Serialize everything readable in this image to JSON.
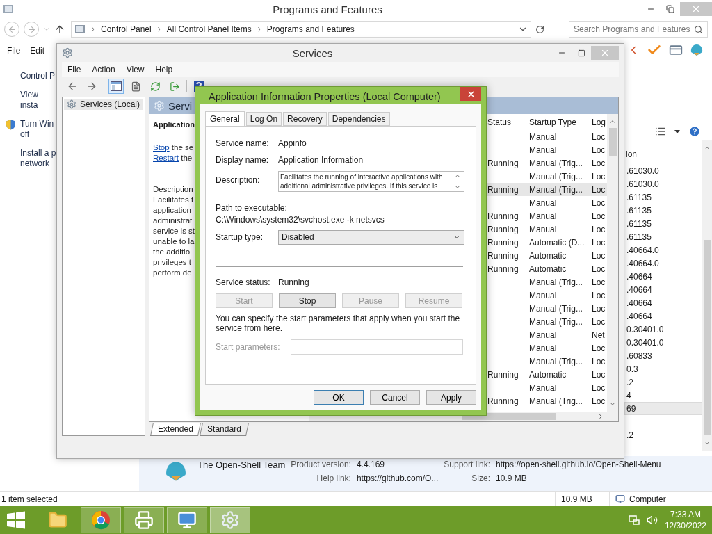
{
  "programs_window": {
    "title": "Programs and Features",
    "address": {
      "breadcrumbs": [
        "Control Panel",
        "All Control Panel Items",
        "Programs and Features"
      ]
    },
    "search": {
      "placeholder": "Search Programs and Features"
    },
    "menu": [
      "File",
      "Edit"
    ],
    "sidebar": {
      "items": [
        {
          "text": "Control P",
          "shield": false
        },
        {
          "text": "View insta",
          "shield": false
        },
        {
          "text": "Turn Win\noff",
          "shield": true
        },
        {
          "text": "Install a p\nnetwork",
          "shield": false
        }
      ]
    },
    "list": {
      "column": "ion",
      "rows": [
        {
          "text": ".61030.0",
          "selected": false
        },
        {
          "text": ".61030.0",
          "selected": false
        },
        {
          "text": ".61135",
          "selected": false
        },
        {
          "text": ".61135",
          "selected": false
        },
        {
          "text": ".61135",
          "selected": false
        },
        {
          "text": ".61135",
          "selected": false
        },
        {
          "text": ".40664.0",
          "selected": false
        },
        {
          "text": ".40664.0",
          "selected": false
        },
        {
          "text": ".40664",
          "selected": false
        },
        {
          "text": ".40664",
          "selected": false
        },
        {
          "text": ".40664",
          "selected": false
        },
        {
          "text": ".40664",
          "selected": false
        },
        {
          "text": "0.30401.0",
          "selected": false
        },
        {
          "text": "0.30401.0",
          "selected": false
        },
        {
          "text": ".60833",
          "selected": false
        },
        {
          "text": "0.3",
          "selected": false
        },
        {
          "text": ".2",
          "selected": false
        },
        {
          "text": "4",
          "selected": false
        },
        {
          "text": "69",
          "selected": true
        }
      ],
      "rows_after_gap": [
        ".2"
      ]
    },
    "details": {
      "publisher": "The Open-Shell Team",
      "fields": [
        {
          "label": "Product version:",
          "value": "4.4.169"
        },
        {
          "label": "Support link:",
          "value": "https://open-shell.github.io/Open-Shell-Menu"
        },
        {
          "label": "Help link:",
          "value": "https://github.com/O..."
        },
        {
          "label": "Size:",
          "value": "10.9 MB"
        }
      ]
    },
    "status_bar": {
      "text": "1 item selected",
      "size": "10.9 MB",
      "zone": "Computer"
    }
  },
  "services_window": {
    "title": "Services",
    "menu": [
      "File",
      "Action",
      "View",
      "Help"
    ],
    "tree": [
      {
        "label": "Services (Local)",
        "selected": true
      }
    ],
    "pane_title": "Servi",
    "detail": {
      "heading": "Application",
      "actions": [
        {
          "link": "Stop",
          "rest": " the se"
        },
        {
          "link": "Restart",
          "rest": " the"
        }
      ],
      "description_label": "Description",
      "description": "Facilitates t\napplication\nadministrat\nservice is st\nunable to la\nthe additio\nprivileges t\nperform de"
    },
    "columns": [
      "Status",
      "Startup Type",
      "Log"
    ],
    "rows": [
      {
        "startup": "Manual",
        "log": "Loc",
        "selected": false
      },
      {
        "startup": "Manual",
        "log": "Loc",
        "selected": false
      },
      {
        "status": "Running",
        "startup": "Manual (Trig...",
        "log": "Loc",
        "selected": false
      },
      {
        "startup": "Manual (Trig...",
        "log": "Loc",
        "selected": false
      },
      {
        "status": "Running",
        "startup": "Manual (Trig...",
        "log": "Loc",
        "selected": true
      },
      {
        "startup": "Manual",
        "log": "Loc",
        "selected": false
      },
      {
        "status": "Running",
        "startup": "Manual",
        "log": "Loc",
        "selected": false
      },
      {
        "status": "Running",
        "startup": "Manual",
        "log": "Loc",
        "selected": false
      },
      {
        "status": "Running",
        "startup": "Automatic (D...",
        "log": "Loc",
        "selected": false
      },
      {
        "status": "Running",
        "startup": "Automatic",
        "log": "Loc",
        "selected": false
      },
      {
        "status": "Running",
        "startup": "Automatic",
        "log": "Loc",
        "selected": false
      },
      {
        "startup": "Manual (Trig...",
        "log": "Loc",
        "selected": false
      },
      {
        "startup": "Manual",
        "log": "Loc",
        "selected": false
      },
      {
        "startup": "Manual (Trig...",
        "log": "Loc",
        "selected": false
      },
      {
        "startup": "Manual (Trig...",
        "log": "Loc",
        "selected": false
      },
      {
        "startup": "Manual",
        "log": "Net",
        "selected": false
      },
      {
        "startup": "Manual",
        "log": "Loc",
        "selected": false
      },
      {
        "startup": "Manual (Trig...",
        "log": "Loc",
        "selected": false
      },
      {
        "status": "Running",
        "startup": "Automatic",
        "log": "Loc",
        "selected": false
      },
      {
        "startup": "Manual",
        "log": "Loc",
        "selected": false
      },
      {
        "status": "Running",
        "startup": "Manual (Trig...",
        "log": "Loc",
        "selected": false
      }
    ],
    "view_tabs": [
      {
        "label": "Extended",
        "selected": true
      },
      {
        "label": "Standard",
        "selected": false
      }
    ]
  },
  "dialog": {
    "title": "Application Information Properties (Local Computer)",
    "tabs": [
      {
        "label": "General",
        "selected": true
      },
      {
        "label": "Log On",
        "selected": false
      },
      {
        "label": "Recovery",
        "selected": false
      },
      {
        "label": "Dependencies",
        "selected": false
      }
    ],
    "fields": [
      {
        "label": "Service name:",
        "value": "Appinfo"
      },
      {
        "label": "Display name:",
        "value": "Application Information"
      }
    ],
    "description": {
      "label": "Description:",
      "text": "Facilitates the running of interactive applications with additional administrative privileges.  If this service is"
    },
    "path": {
      "label": "Path to executable:",
      "value": "C:\\Windows\\system32\\svchost.exe -k netsvcs"
    },
    "startup": {
      "label": "Startup type:",
      "value": "Disabled"
    },
    "status": {
      "label": "Service status:",
      "value": "Running"
    },
    "control_buttons": [
      {
        "label": "Start",
        "disabled": true
      },
      {
        "label": "Stop",
        "disabled": false
      },
      {
        "label": "Pause",
        "disabled": true
      },
      {
        "label": "Resume",
        "disabled": true
      }
    ],
    "hint": "You can specify the start parameters that apply when you start the service from here.",
    "parameters": {
      "label": "Start parameters:",
      "disabled": true
    },
    "buttons": [
      {
        "label": "OK",
        "default": true
      },
      {
        "label": "Cancel",
        "default": false
      },
      {
        "label": "Apply",
        "default": false
      }
    ]
  },
  "taskbar": {
    "apps": [
      {
        "kind": "explorer",
        "running": false,
        "selected": false
      },
      {
        "kind": "chrome",
        "running": true,
        "selected": false
      },
      {
        "kind": "printer",
        "running": true,
        "selected": false
      },
      {
        "kind": "control-panel",
        "running": true,
        "selected": false
      },
      {
        "kind": "services",
        "running": true,
        "selected": true
      }
    ],
    "time": "7:33 AM",
    "date": "12/30/2022"
  }
}
